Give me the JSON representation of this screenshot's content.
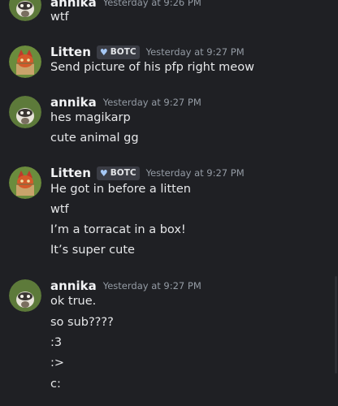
{
  "messages": [
    {
      "author": "annika",
      "timestamp": "Yesterday at 9:26 PM",
      "lines": [
        "wtf"
      ]
    },
    {
      "author": "Litten",
      "badge": "BOTC",
      "timestamp": "Yesterday at 9:27 PM",
      "lines": [
        "Send picture of his pfp right meow"
      ]
    },
    {
      "author": "annika",
      "timestamp": "Yesterday at 9:27 PM",
      "lines": [
        "hes magikarp",
        "cute animal gg"
      ]
    },
    {
      "author": "Litten",
      "badge": "BOTC",
      "timestamp": "Yesterday at 9:27 PM",
      "lines": [
        "He got in before a litten",
        "wtf",
        "I’m a torracat in a box!",
        "It’s super cute"
      ]
    },
    {
      "author": "annika",
      "timestamp": "Yesterday at 9:27 PM",
      "lines": [
        "ok true.",
        "so sub????",
        ":3",
        ":>",
        "c:"
      ]
    }
  ],
  "colors": {
    "background": "#1f2024",
    "username": "#f2f3f5",
    "timestamp": "#949ba4",
    "message_text": "#e6e7e9",
    "badge_bg": "#3a3c44"
  },
  "icons": {
    "annika_avatar": "raccoon-avatar-icon",
    "litten_avatar": "cat-avatar-icon",
    "badge_icon": "heart-icon"
  }
}
